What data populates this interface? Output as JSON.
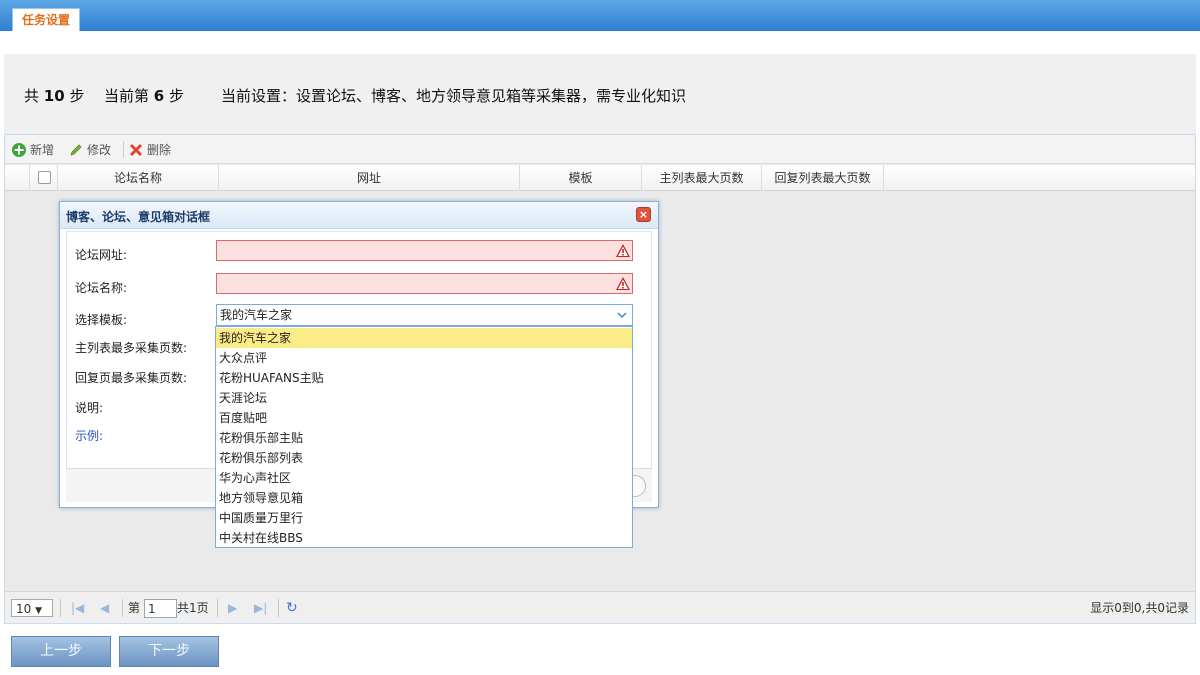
{
  "tab": "任务设置",
  "steps": {
    "total_prefix": "共",
    "total": "10",
    "total_suffix": "步",
    "current_prefix": "当前第",
    "current": "6",
    "current_suffix": "步",
    "desc": "当前设置：设置论坛、博客、地方领导意见箱等采集器，需专业化知识"
  },
  "toolbar": {
    "add": "新增",
    "edit": "修改",
    "delete": "删除"
  },
  "columns": [
    "论坛名称",
    "网址",
    "模板",
    "主列表最大页数",
    "回复列表最大页数"
  ],
  "pager": {
    "page_size": "10",
    "page_prefix": "第",
    "page": "1",
    "page_total": "共1页",
    "summary": "显示0到0,共0记录"
  },
  "nav": {
    "prev": "上一步",
    "next": "下一步"
  },
  "dialog": {
    "title": "博客、论坛、意见箱对话框",
    "labels": {
      "url": "论坛网址:",
      "name": "论坛名称:",
      "template": "选择模板:",
      "main_pages": "主列表最多采集页数:",
      "reply_pages": "回复页最多采集页数:",
      "desc": "说明:",
      "example": "示例:"
    },
    "selected_template": "我的汽车之家",
    "options": [
      "我的汽车之家",
      "大众点评",
      "花粉HUAFANS主贴",
      "天涯论坛",
      "百度贴吧",
      "花粉俱乐部主贴",
      "花粉俱乐部列表",
      "华为心声社区",
      "地方领导意见箱",
      "中国质量万里行",
      "中关村在线BBS"
    ]
  },
  "colors": {
    "accent": "#2f7fcf",
    "tab_text": "#e46d1a",
    "error_bg": "#fde0e0",
    "highlight": "#fbec88"
  }
}
